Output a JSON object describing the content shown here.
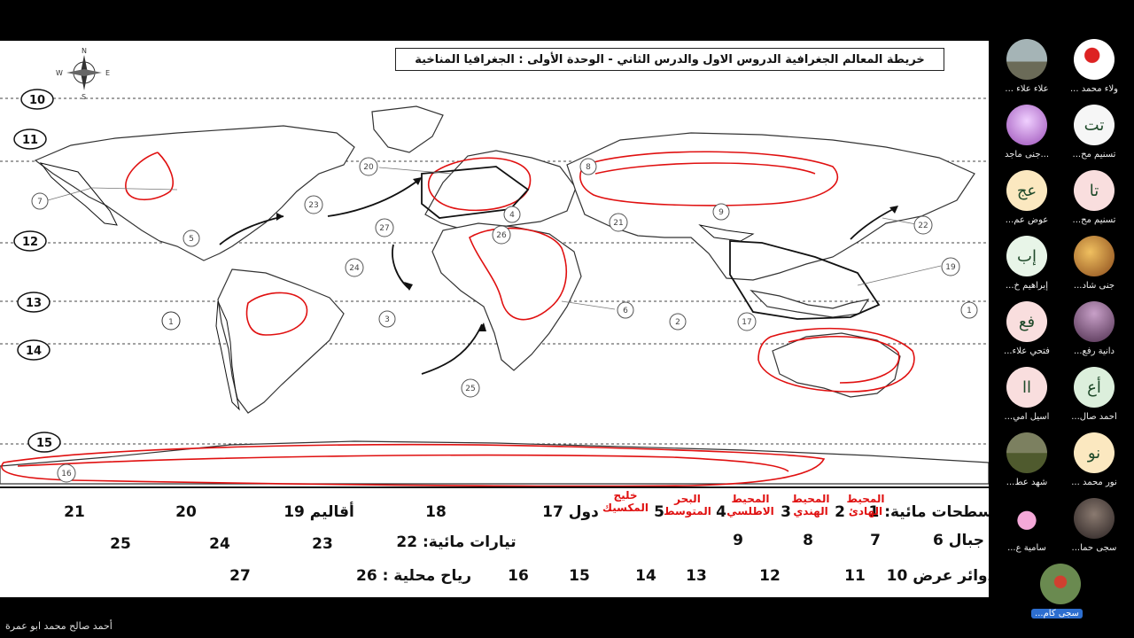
{
  "screen": {
    "title": "خريطة المعالم الجغرافية  الدروس الاول والدرس الثاني - الوحدة الأولى : الجغرافيا المناخية",
    "compass": {
      "n": "N",
      "s": "S",
      "e": "E",
      "w": "W"
    },
    "circle_labels": [
      "1",
      "2",
      "3",
      "4",
      "5",
      "6",
      "7",
      "8",
      "9",
      "17",
      "19",
      "20",
      "21",
      "22",
      "23",
      "24",
      "25",
      "26",
      "27",
      "1",
      "16"
    ],
    "latitude_labels": [
      "10",
      "11",
      "12",
      "13",
      "14",
      "15"
    ]
  },
  "legend": {
    "row1": {
      "label": "مسطحات مائية: 1",
      "n2": "2",
      "n3": "3",
      "n4": "4",
      "n5": "5",
      "n17": "17",
      "n18": "18",
      "n19": "19",
      "n20": "20",
      "n21": "21",
      "duwal": "دول",
      "aqalim": "أقاليم"
    },
    "handwritten": {
      "pacific": "المحيط\nالهادئ",
      "indian": "المحيط\nالهندي",
      "atlantic": "المحيط\nالاطلسي",
      "med": "البحر\nالمتوسط",
      "gulf": "خليج\nالمكسيك"
    },
    "row2": {
      "label": "جبال 6",
      "n7": "7",
      "n8": "8",
      "n9": "9",
      "currents": "تيارات مائية: 22",
      "n23": "23",
      "n24": "24",
      "n25": "25"
    },
    "row3": {
      "label": "دوائر عرض 10",
      "n11": "11",
      "n12": "12",
      "n13": "13",
      "n14": "14",
      "n15": "15",
      "n16": "16",
      "winds": "رياح محلية : 26",
      "n27": "27"
    }
  },
  "presenter": "أحمد صالح محمد ابو عمرة",
  "participants": [
    {
      "name": "ولاء محمد ...",
      "initials": "",
      "color": "#f0f0f0",
      "photo": "rose"
    },
    {
      "name": "علاء علاء ...",
      "initials": "",
      "color": "#7f8c8f",
      "photo": "beach"
    },
    {
      "name": "تسنيم مح...",
      "initials": "تت",
      "color": "#f6f6f6",
      "photo": ""
    },
    {
      "name": "...جنى ماجد",
      "initials": "",
      "color": "#c090d0",
      "photo": "purple"
    },
    {
      "name": "تسنيم مح...",
      "initials": "تا",
      "color": "#f9dede",
      "photo": ""
    },
    {
      "name": "عوض عم...",
      "initials": "عج",
      "color": "#fbe8c0",
      "photo": ""
    },
    {
      "name": "جنى شاد...",
      "initials": "",
      "color": "#c4782a",
      "photo": "warm"
    },
    {
      "name": "إبراهيم خ...",
      "initials": "إب",
      "color": "#e8f5e8",
      "photo": ""
    },
    {
      "name": "دانية رفع...",
      "initials": "",
      "color": "#704060",
      "photo": "dark"
    },
    {
      "name": "فتحي علاء...",
      "initials": "فع",
      "color": "#f9dede",
      "photo": ""
    },
    {
      "name": "أحمد صال...",
      "initials": "أع",
      "color": "#dcefdc",
      "photo": ""
    },
    {
      "name": "اسيل امي...",
      "initials": "اا",
      "color": "#f9dede",
      "photo": ""
    },
    {
      "name": "نور محمد ...",
      "initials": "نو",
      "color": "#fbe8c0",
      "photo": ""
    },
    {
      "name": "شهد عط...",
      "initials": "",
      "color": "#6d6a3a",
      "photo": "field"
    },
    {
      "name": "سجى حما...",
      "initials": "",
      "color": "#4a4040",
      "photo": "dark2"
    },
    {
      "name": "سامية ع...",
      "initials": "",
      "color": "#000000",
      "photo": "pink"
    },
    {
      "name": "سجى كام...",
      "initials": "",
      "color": "#557040",
      "photo": "self"
    }
  ]
}
